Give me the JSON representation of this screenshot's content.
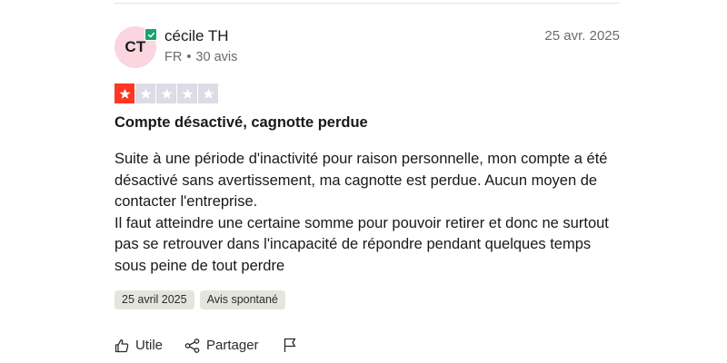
{
  "review": {
    "author": {
      "initials": "CT",
      "name": "cécile TH",
      "country": "FR",
      "separator": "•",
      "review_count": "30 avis"
    },
    "date": "25 avr. 2025",
    "rating": 1,
    "max_rating": 5,
    "title": "Compte désactivé, cagnotte perdue",
    "body": [
      "Suite à une période d'inactivité pour raison personnelle, mon compte a été désactivé sans avertissement, ma cagnotte est perdue. Aucun moyen de contacter l'entreprise.",
      "Il faut atteindre une certaine somme pour pouvoir retirer et donc ne surtout pas se retrouver dans l'incapacité de répondre pendant quelques temps sous peine de tout perdre"
    ],
    "tags": [
      "25 avril 2025",
      "Avis spontané"
    ],
    "actions": {
      "useful": "Utile",
      "share": "Partager"
    }
  },
  "colors": {
    "avatar_bg": "#fbd5e0",
    "verified": "#1aa36f",
    "star_filled": "#ff3722",
    "star_empty": "#dcdce6",
    "tag_bg": "#e5e5dd"
  },
  "icons": [
    "verified-check-icon",
    "star-icon",
    "thumbs-up-icon",
    "share-icon",
    "flag-icon"
  ]
}
